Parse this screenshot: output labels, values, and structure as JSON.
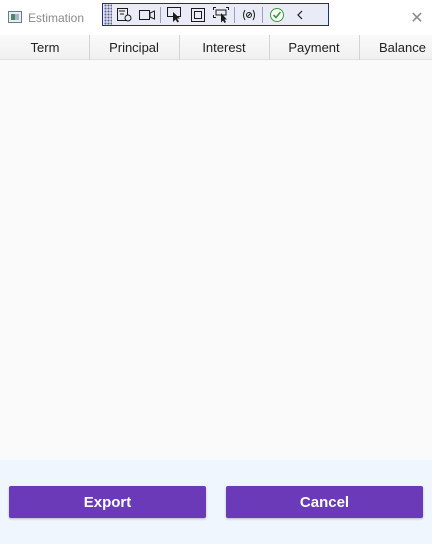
{
  "window": {
    "title": "Estimation",
    "close_glyph": "✕",
    "icon": "app-window-icon"
  },
  "debug_toolbar": {
    "buttons": [
      {
        "name": "live-visual-tree-icon"
      },
      {
        "name": "record-icon"
      },
      {
        "name": "select-element-icon"
      },
      {
        "name": "display-layout-adorners-icon"
      },
      {
        "name": "track-focused-element-icon"
      },
      {
        "name": "binding-failures-icon"
      },
      {
        "name": "accessibility-check-icon"
      },
      {
        "name": "collapse-chevron-icon"
      }
    ]
  },
  "grid": {
    "columns": [
      "Term",
      "Principal",
      "Interest",
      "Payment",
      "Balance"
    ],
    "rows": []
  },
  "actions": {
    "export_label": "Export",
    "cancel_label": "Cancel"
  },
  "colors": {
    "accent": "#6a3ab8",
    "footer_bg": "#f0f6fd",
    "grid_bg": "#fafafa"
  }
}
